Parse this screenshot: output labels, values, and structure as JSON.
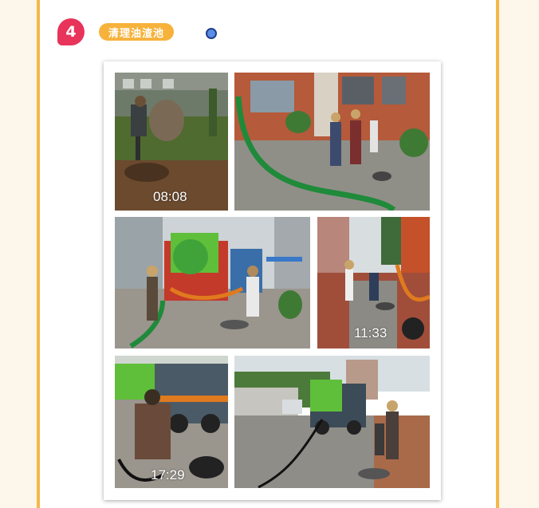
{
  "section": {
    "number": "4",
    "title": "清理油渣池"
  },
  "photos": [
    {
      "id": "p1",
      "timestamp": "08:08"
    },
    {
      "id": "p2",
      "timestamp": ""
    },
    {
      "id": "p3",
      "timestamp": ""
    },
    {
      "id": "p4",
      "timestamp": "11:33"
    },
    {
      "id": "p5",
      "timestamp": "17:29"
    },
    {
      "id": "p6",
      "timestamp": ""
    }
  ],
  "colors": {
    "border_accent": "#f4b84a",
    "badge": "#e8345a",
    "title_pill": "#f7b23b",
    "dot": "#5b8de6"
  },
  "icons": [
    "bullet-dot-icon"
  ]
}
